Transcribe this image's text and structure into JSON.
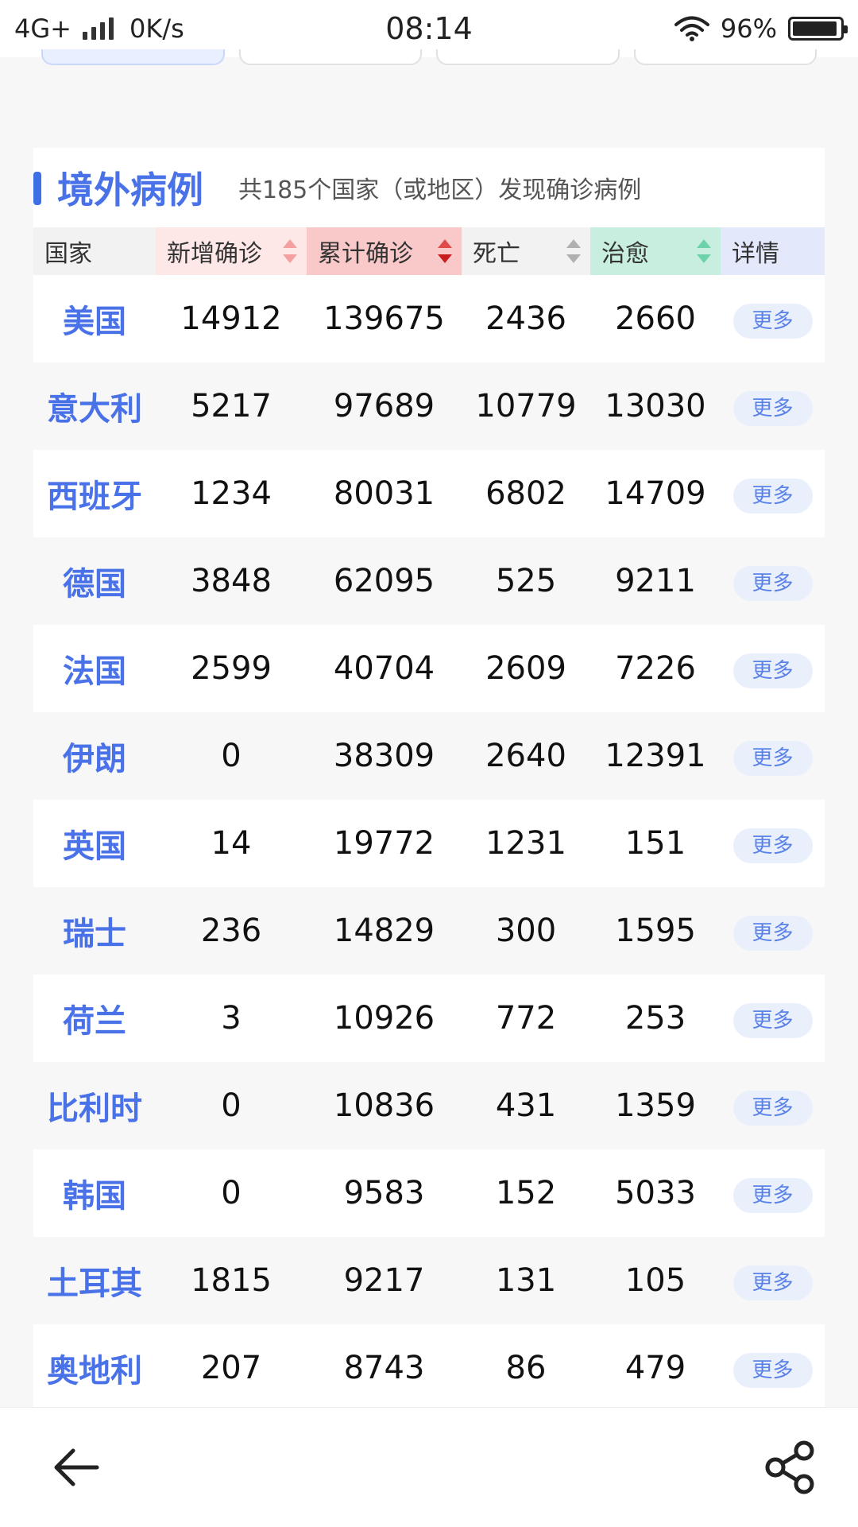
{
  "status_bar": {
    "network": "4G+",
    "speed": "0K/s",
    "time": "08:14",
    "battery": "96%",
    "battery_level": 0.96
  },
  "section": {
    "title": "境外病例",
    "subtitle": "共185个国家（或地区）发现确诊病例"
  },
  "table": {
    "columns": [
      "国家",
      "新增确诊",
      "累计确诊",
      "死亡",
      "治愈",
      "详情"
    ],
    "more_label": "更多",
    "header_colors": [
      "#f2f2f2",
      "#fde7e7",
      "#f9c9c9",
      "#f2f2f2",
      "#c8eedf",
      "#e3e8fb"
    ],
    "rows": [
      [
        "美国",
        "14912",
        "139675",
        "2436",
        "2660"
      ],
      [
        "意大利",
        "5217",
        "97689",
        "10779",
        "13030"
      ],
      [
        "西班牙",
        "1234",
        "80031",
        "6802",
        "14709"
      ],
      [
        "德国",
        "3848",
        "62095",
        "525",
        "9211"
      ],
      [
        "法国",
        "2599",
        "40704",
        "2609",
        "7226"
      ],
      [
        "伊朗",
        "0",
        "38309",
        "2640",
        "12391"
      ],
      [
        "英国",
        "14",
        "19772",
        "1231",
        "151"
      ],
      [
        "瑞士",
        "236",
        "14829",
        "300",
        "1595"
      ],
      [
        "荷兰",
        "3",
        "10926",
        "772",
        "253"
      ],
      [
        "比利时",
        "0",
        "10836",
        "431",
        "1359"
      ],
      [
        "韩国",
        "0",
        "9583",
        "152",
        "5033"
      ],
      [
        "土耳其",
        "1815",
        "9217",
        "131",
        "105"
      ],
      [
        "奥地利",
        "207",
        "8743",
        "86",
        "479"
      ]
    ]
  },
  "bottom_bar": {
    "back_icon": "arrow-left-icon",
    "share_icon": "share-icon"
  }
}
